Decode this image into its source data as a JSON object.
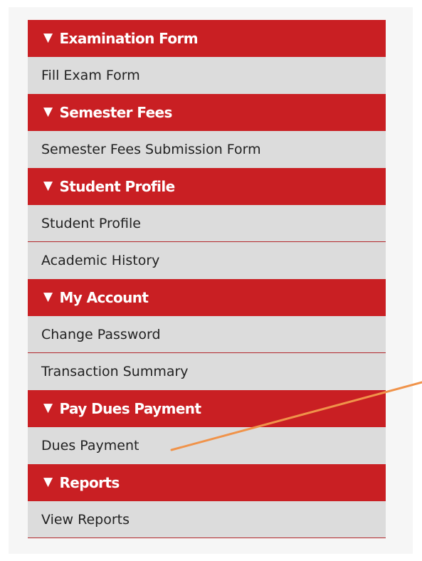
{
  "menu": {
    "sections": [
      {
        "header": "Examination Form",
        "items": [
          "Fill Exam Form"
        ]
      },
      {
        "header": "Semester Fees",
        "items": [
          "Semester Fees Submission Form"
        ]
      },
      {
        "header": "Student Profile",
        "items": [
          "Student Profile",
          "Academic History"
        ]
      },
      {
        "header": "My Account",
        "items": [
          "Change Password",
          "Transaction Summary"
        ]
      },
      {
        "header": "Pay Dues Payment",
        "items": [
          "Dues Payment"
        ]
      },
      {
        "header": "Reports",
        "items": [
          "View Reports"
        ]
      }
    ]
  },
  "colors": {
    "header_bg": "#c91f23",
    "item_bg": "#dcdcdc",
    "annotation_line": "#f0934a"
  },
  "icons": {
    "section_toggle": "triangle-down-icon"
  }
}
